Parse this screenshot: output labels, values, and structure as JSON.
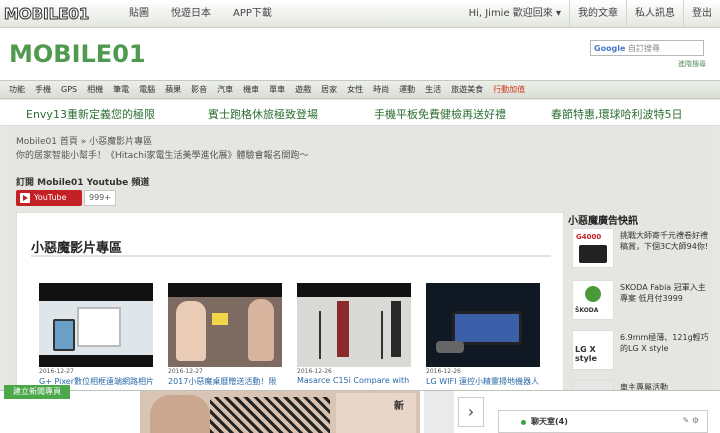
{
  "topbar": {
    "logo": "MOBILE01",
    "nav_left": [
      "貼圖",
      "悅遊日本",
      "APP下載"
    ],
    "nav_right": [
      "Hi, Jimie 歡迎回來 ▾",
      "我的文章",
      "私人訊息",
      "登出"
    ]
  },
  "header": {
    "logo": "MOBILE01",
    "search_brand": "Google",
    "search_placeholder": "自訂搜尋",
    "search_link": "進階搜尋"
  },
  "categories": [
    "功能",
    "手機",
    "GPS",
    "相機",
    "筆電",
    "電腦",
    "蘋果",
    "影音",
    "汽車",
    "機車",
    "單車",
    "遊戲",
    "居家",
    "女性",
    "時尚",
    "運動",
    "生活",
    "旅遊美食",
    "行動加值"
  ],
  "ads": [
    "Envy13重新定義您的極限",
    "賓士跑格休旅極致登場",
    "手機平板免費健檢再送好禮",
    "春節特惠,環球哈利波特5日"
  ],
  "breadcrumb": "Mobile01 首頁 » 小惡魔影片專區",
  "subnote": "你的居家智能小幫手！《Hitachi家電生活美學進化展》體驗會報名開跑～",
  "subscribe": {
    "label": "訂閱 Mobile01 Youtube 頻道",
    "button": "YouTube",
    "count": "999+"
  },
  "panel": {
    "title": "小惡魔影片專區",
    "videos": [
      {
        "date": "2016-12-27",
        "title": "G+ Pixer數位相框遠端網路相片"
      },
      {
        "date": "2016-12-27",
        "title": "2017小惡魔桌曆贈送活動！限"
      },
      {
        "date": "2016-12-26",
        "title": "Masarce C15i Compare with"
      },
      {
        "date": "2016-12-26",
        "title": "LG WIFI 遠控小精靈掃地機器人"
      }
    ]
  },
  "sidebar": {
    "title": "小惡魔廣告快訊",
    "items": [
      {
        "thumb": "G4000",
        "text": "挑戰大師寄千元禮卷好禮稿賞，下個3C大師94你!"
      },
      {
        "thumb": "ŠKODA",
        "text": "SKODA Fabia 冠軍入主專案 低月付3999"
      },
      {
        "thumb": "LG X style",
        "text": "6.9mm極薄、121g輕巧的LG X style"
      },
      {
        "thumb": "",
        "text": "車主專屬活動"
      }
    ]
  },
  "bottom": {
    "green_btn": "建立新聞專頁",
    "banner_text": "新",
    "next": "›",
    "chat_label": "聊天室(4)",
    "chat_icons": "✎ ⚙",
    "side_link": "關"
  },
  "colors": {
    "green": "#2c6e30",
    "youtube": "#c42126",
    "link": "#2a6aa8",
    "highlight": "#d03a1a"
  }
}
